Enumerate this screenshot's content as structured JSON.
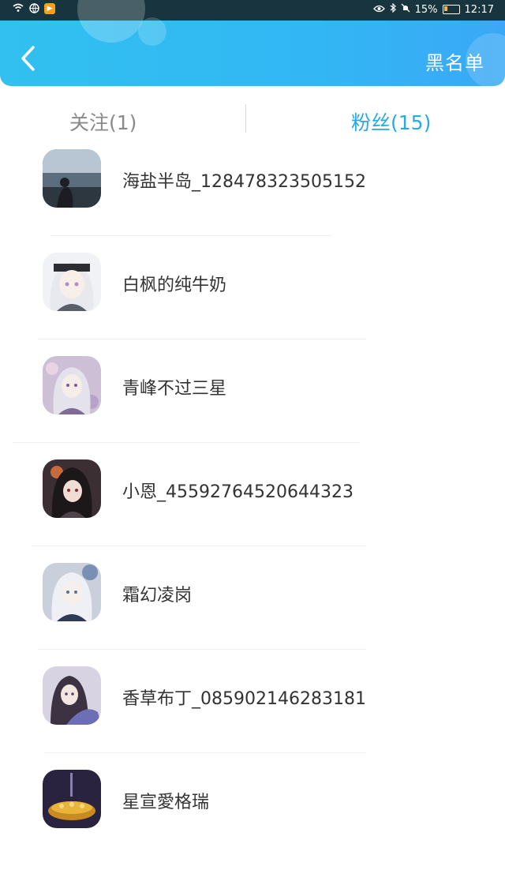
{
  "status_bar": {
    "battery": "15%",
    "time": "12:17",
    "battery_color": "#f0b545"
  },
  "header": {
    "back_icon": "chevron-left-icon",
    "action_label": "黑名单",
    "gradient_start": "#31c0ef",
    "gradient_end": "#3aa8f6"
  },
  "tabs": [
    {
      "label": "关注(1)",
      "active": false
    },
    {
      "label": "粉丝(15)",
      "active": true
    }
  ],
  "colors": {
    "active_tab": "#27a9e6",
    "inactive_tab": "#8a8a8a",
    "text": "#333333"
  },
  "fans": [
    {
      "name": "海盐半岛_128478323505152",
      "avatar": "avatar-seaside"
    },
    {
      "name": "白枫的纯牛奶",
      "avatar": "avatar-white-hair-anime"
    },
    {
      "name": "青峰不过三星",
      "avatar": "avatar-anime-girl-flowers"
    },
    {
      "name": "小恩_45592764520644323",
      "avatar": "avatar-dark-hair-anime"
    },
    {
      "name": "霜幻凌岗",
      "avatar": "avatar-silver-hair-anime"
    },
    {
      "name": "香草布丁_085902146283181",
      "avatar": "avatar-purple-anime"
    },
    {
      "name": "星宣愛格瑞",
      "avatar": "avatar-golden-crown"
    }
  ]
}
